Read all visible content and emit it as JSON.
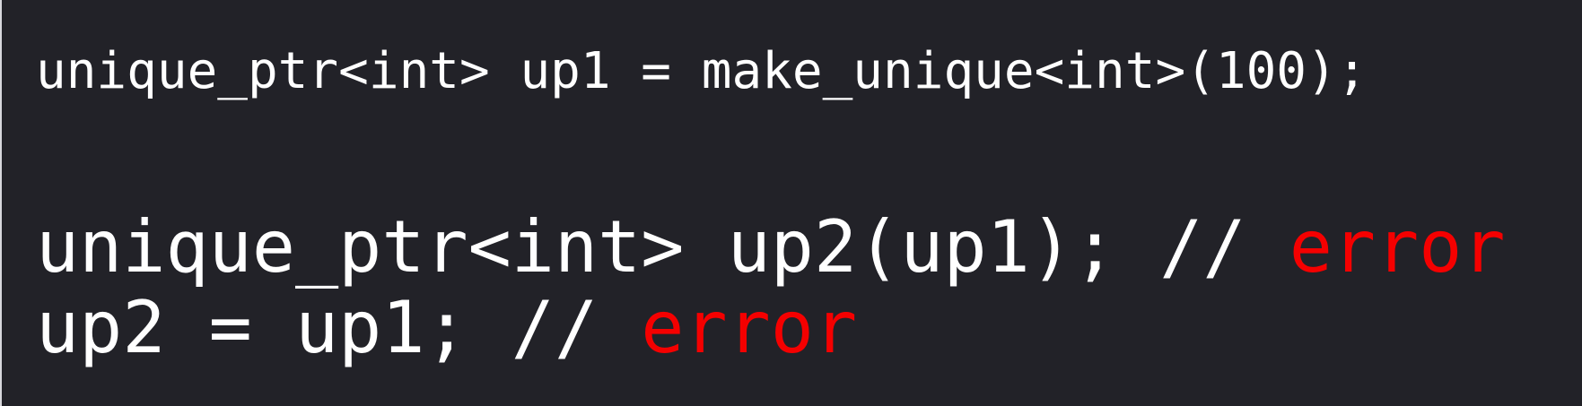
{
  "code": {
    "line1": "unique_ptr<int> up1 = make_unique<int>(100);",
    "line2_code": "unique_ptr<int> up2(up1); // ",
    "line2_error": "error",
    "line3_code": "up2 = up1; // ",
    "line3_error": "error"
  },
  "colors": {
    "background": "#222228",
    "text": "#ffffff",
    "error": "#f50000"
  }
}
